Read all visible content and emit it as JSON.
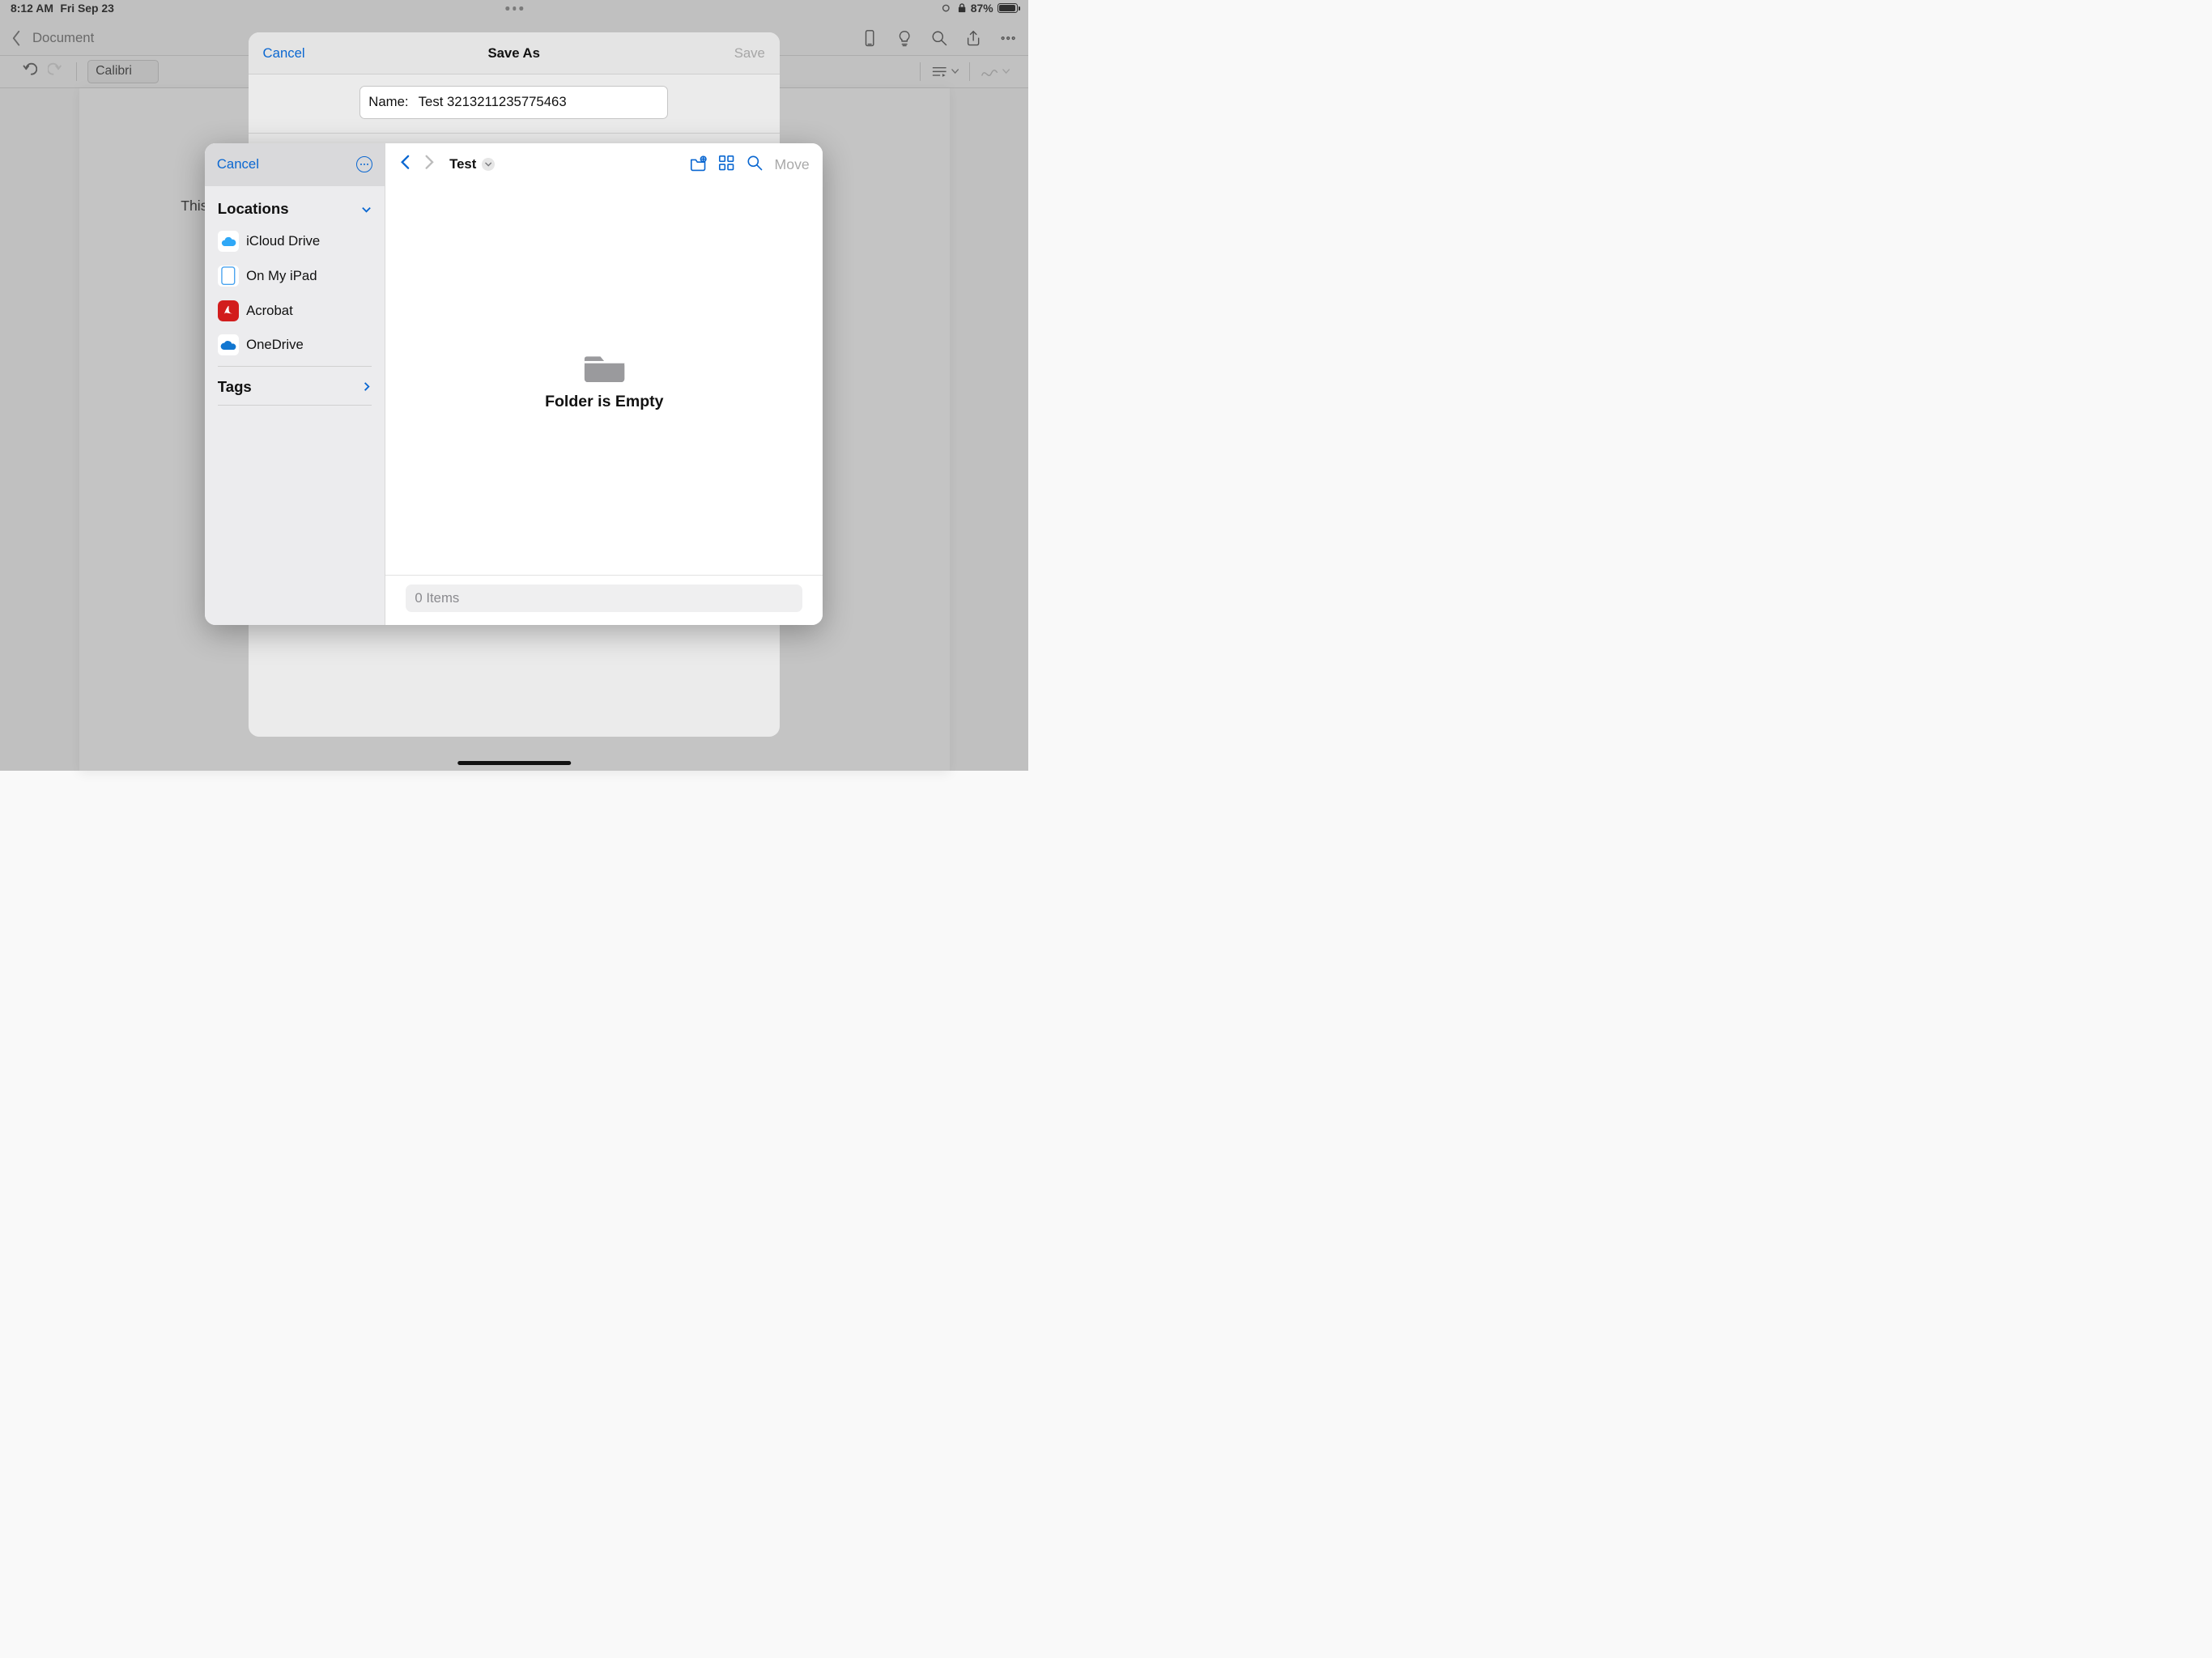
{
  "statusbar": {
    "time": "8:12 AM",
    "date": "Fri Sep 23",
    "battery_pct": "87%"
  },
  "toolbar": {
    "back_label": "Document",
    "font_name": "Calibri"
  },
  "document": {
    "visible_text_fragment": "This"
  },
  "saveas": {
    "cancel": "Cancel",
    "title": "Save As",
    "save": "Save",
    "name_label": "Name:",
    "name_value": "Test 3213211235775463"
  },
  "picker": {
    "cancel": "Cancel",
    "locations_header": "Locations",
    "locations": [
      {
        "label": "iCloud Drive",
        "icon": "icloud"
      },
      {
        "label": "On My iPad",
        "icon": "ipad"
      },
      {
        "label": "Acrobat",
        "icon": "acrobat"
      },
      {
        "label": "OneDrive",
        "icon": "onedrive"
      }
    ],
    "tags_header": "Tags",
    "breadcrumb": "Test",
    "move": "Move",
    "empty_message": "Folder is Empty",
    "item_count": "0 Items"
  }
}
